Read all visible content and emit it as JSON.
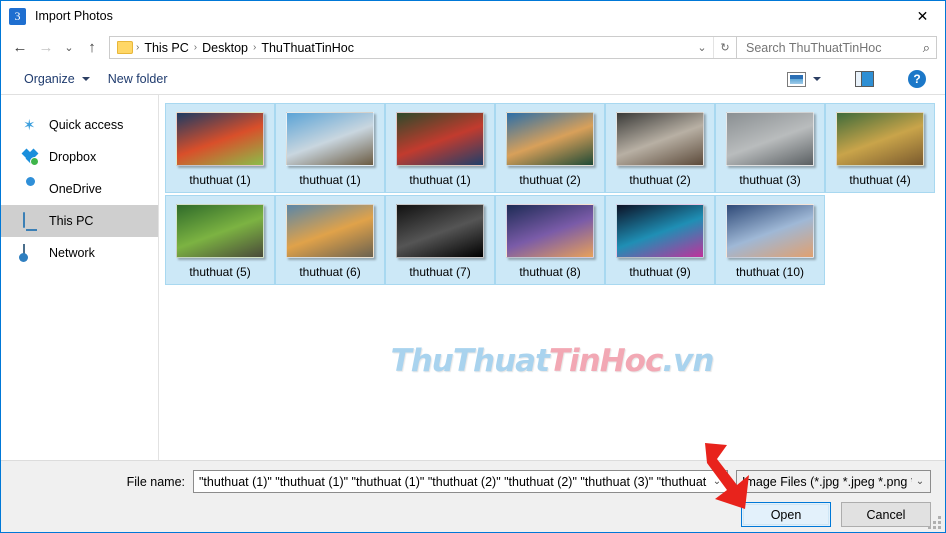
{
  "window": {
    "title": "Import Photos",
    "app_icon": "3",
    "close_label": "✕"
  },
  "nav": {
    "back_icon": "←",
    "forward_icon": "→",
    "recent_icon": "⌄",
    "up_icon": "↑",
    "breadcrumb": [
      "This PC",
      "Desktop",
      "ThuThuatTinHoc"
    ],
    "separator": "›",
    "dropdown_icon": "⌄",
    "refresh_icon": "↻"
  },
  "search": {
    "placeholder": "Search ThuThuatTinHoc",
    "value": "",
    "icon": "⌕"
  },
  "toolbar": {
    "organize_label": "Organize",
    "new_folder_label": "New folder",
    "help_label": "?"
  },
  "sidebar": {
    "items": [
      {
        "label": "Quick access",
        "icon": "star-icon",
        "selected": false
      },
      {
        "label": "Dropbox",
        "icon": "dropbox-icon",
        "selected": false
      },
      {
        "label": "OneDrive",
        "icon": "cloud-icon",
        "selected": false
      },
      {
        "label": "This PC",
        "icon": "computer-icon",
        "selected": true
      },
      {
        "label": "Network",
        "icon": "network-icon",
        "selected": false
      }
    ]
  },
  "files": [
    {
      "label": "thuthuat (1)",
      "colors": [
        "#1b3a63",
        "#d94f2a",
        "#8bbd4a"
      ],
      "selected": true
    },
    {
      "label": "thuthuat (1)",
      "colors": [
        "#5ba3d6",
        "#c9d6df",
        "#6b5b42"
      ],
      "selected": true
    },
    {
      "label": "thuthuat (1)",
      "colors": [
        "#2d4a2a",
        "#c23b2e",
        "#1f3f6b"
      ],
      "selected": true
    },
    {
      "label": "thuthuat (2)",
      "colors": [
        "#2b6ea8",
        "#d8a05a",
        "#1f4a36"
      ],
      "selected": true
    },
    {
      "label": "thuthuat (2)",
      "colors": [
        "#3a3a38",
        "#b8b0a4",
        "#5c4a3a"
      ],
      "selected": true
    },
    {
      "label": "thuthuat (3)",
      "colors": [
        "#8a8f92",
        "#b9bcbd",
        "#5a5f62"
      ],
      "selected": true
    },
    {
      "label": "thuthuat (4)",
      "colors": [
        "#3f6b3a",
        "#c9a44a",
        "#7a5a2e"
      ],
      "selected": true
    },
    {
      "label": "thuthuat (5)",
      "colors": [
        "#2f6b2a",
        "#7cb342",
        "#4a4a3a"
      ],
      "selected": true
    },
    {
      "label": "thuthuat (6)",
      "colors": [
        "#5a86a8",
        "#e0a24a",
        "#6b6250"
      ],
      "selected": true
    },
    {
      "label": "thuthuat (7)",
      "colors": [
        "#111111",
        "#555555",
        "#000000"
      ],
      "selected": true
    },
    {
      "label": "thuthuat (8)",
      "colors": [
        "#1d2b55",
        "#7a5ba8",
        "#e8a15a"
      ],
      "selected": true
    },
    {
      "label": "thuthuat (9)",
      "colors": [
        "#0c1226",
        "#1f8fb5",
        "#c0329b"
      ],
      "selected": true
    },
    {
      "label": "thuthuat (10)",
      "colors": [
        "#2f4a78",
        "#9fb8d6",
        "#e0a070"
      ],
      "selected": true
    }
  ],
  "watermark": {
    "part1": "ThuThuat",
    "part2": "TinHoc",
    "part3": ".vn"
  },
  "bottom": {
    "file_name_label": "File name:",
    "file_name_value": "\"thuthuat (1)\" \"thuthuat (1)\" \"thuthuat (1)\" \"thuthuat (2)\" \"thuthuat (2)\" \"thuthuat (3)\" \"thuthuat (",
    "file_type_value": "Image Files (*.jpg *.jpeg *.png *",
    "open_label": "Open",
    "cancel_label": "Cancel",
    "dropdown_icon": "⌄"
  },
  "colors": {
    "accent": "#0078d7",
    "selection": "#cce8f7",
    "annotation_arrow": "#e8231c"
  }
}
